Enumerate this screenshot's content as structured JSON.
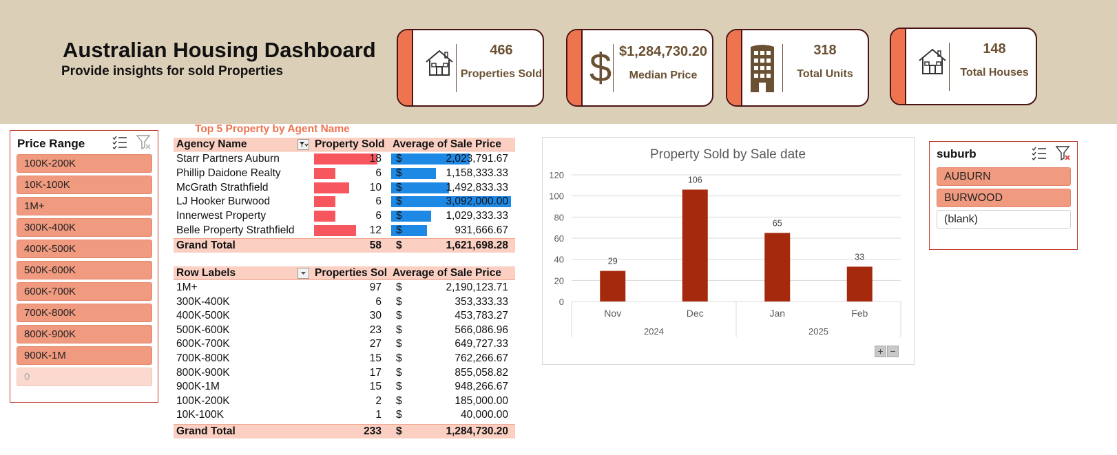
{
  "header": {
    "title": "Australian Housing Dashboard",
    "subtitle": "Provide insights for sold Properties"
  },
  "kpis": [
    {
      "value": "466",
      "label": "Properties Sold",
      "icon": "house-icon"
    },
    {
      "value": "$1,284,730.20",
      "label": "Median Price",
      "icon": "dollar-icon"
    },
    {
      "value": "318",
      "label": "Total Units",
      "icon": "building-icon"
    },
    {
      "value": "148",
      "label": "Total Houses",
      "icon": "house-icon"
    }
  ],
  "price_slicer": {
    "title": "Price Range",
    "items": [
      "100K-200K",
      "10K-100K",
      "1M+",
      "300K-400K",
      "400K-500K",
      "500K-600K",
      "600K-700K",
      "700K-800K",
      "800K-900K",
      "900K-1M",
      "0"
    ]
  },
  "suburb_slicer": {
    "title": "suburb",
    "items": [
      "AUBURN",
      "BURWOOD",
      "(blank)"
    ]
  },
  "agent_table": {
    "caption": "Top 5 Property by Agent Name",
    "headers": [
      "Agency Name",
      "Property Sold",
      "Average of Sale Price"
    ],
    "rows": [
      {
        "name": "Starr Partners Auburn",
        "sold": "18",
        "cur": "$",
        "avg": "2,023,791.67",
        "sold_n": 18,
        "avg_n": 2023791.67
      },
      {
        "name": "Phillip Daidone Realty",
        "sold": "6",
        "cur": "$",
        "avg": "1,158,333.33",
        "sold_n": 6,
        "avg_n": 1158333.33
      },
      {
        "name": "McGrath Strathfield",
        "sold": "10",
        "cur": "$",
        "avg": "1,492,833.33",
        "sold_n": 10,
        "avg_n": 1492833.33
      },
      {
        "name": "LJ Hooker Burwood",
        "sold": "6",
        "cur": "$",
        "avg": "3,092,000.00",
        "sold_n": 6,
        "avg_n": 3092000.0
      },
      {
        "name": "Innerwest Property",
        "sold": "6",
        "cur": "$",
        "avg": "1,029,333.33",
        "sold_n": 6,
        "avg_n": 1029333.33
      },
      {
        "name": "Belle Property Strathfield",
        "sold": "12",
        "cur": "$",
        "avg": "931,666.67",
        "sold_n": 12,
        "avg_n": 931666.67
      }
    ],
    "total": {
      "label": "Grand Total",
      "sold": "58",
      "cur": "$",
      "avg": "1,621,698.28"
    }
  },
  "range_table": {
    "headers": [
      "Row Labels",
      "Properties Sol",
      "Average of Sale Price"
    ],
    "rows": [
      {
        "name": "1M+",
        "sold": "97",
        "cur": "$",
        "avg": "2,190,123.71"
      },
      {
        "name": "300K-400K",
        "sold": "6",
        "cur": "$",
        "avg": "353,333.33"
      },
      {
        "name": "400K-500K",
        "sold": "30",
        "cur": "$",
        "avg": "453,783.27"
      },
      {
        "name": "500K-600K",
        "sold": "23",
        "cur": "$",
        "avg": "566,086.96"
      },
      {
        "name": "600K-700K",
        "sold": "27",
        "cur": "$",
        "avg": "649,727.33"
      },
      {
        "name": "700K-800K",
        "sold": "15",
        "cur": "$",
        "avg": "762,266.67"
      },
      {
        "name": "800K-900K",
        "sold": "17",
        "cur": "$",
        "avg": "855,058.82"
      },
      {
        "name": "900K-1M",
        "sold": "15",
        "cur": "$",
        "avg": "948,266.67"
      },
      {
        "name": "100K-200K",
        "sold": "2",
        "cur": "$",
        "avg": "185,000.00"
      },
      {
        "name": "10K-100K",
        "sold": "1",
        "cur": "$",
        "avg": "40,000.00"
      }
    ],
    "total": {
      "label": "Grand Total",
      "sold": "233",
      "cur": "$",
      "avg": "1,284,730.20"
    }
  },
  "chart_data": {
    "type": "bar",
    "title": "Property Sold by Sale date",
    "categories": [
      "Nov",
      "Dec",
      "Jan",
      "Feb"
    ],
    "groups": [
      {
        "label": "2024",
        "categories": [
          "Nov",
          "Dec"
        ]
      },
      {
        "label": "2025",
        "categories": [
          "Jan",
          "Feb"
        ]
      }
    ],
    "values": [
      29,
      106,
      65,
      33
    ],
    "ylim": [
      0,
      120
    ],
    "yticks": [
      0,
      20,
      40,
      60,
      80,
      100,
      120
    ],
    "grid": true,
    "color": "#a52a0d",
    "xlabel": "",
    "ylabel": ""
  },
  "chart_controls": {
    "plus": "+",
    "minus": "−"
  },
  "colors": {
    "banner": "#dccfb8",
    "accent": "#ee7450",
    "bar_red": "#f8565f",
    "bar_blue": "#1e88e5",
    "slicer_selected": "#f09a80"
  }
}
